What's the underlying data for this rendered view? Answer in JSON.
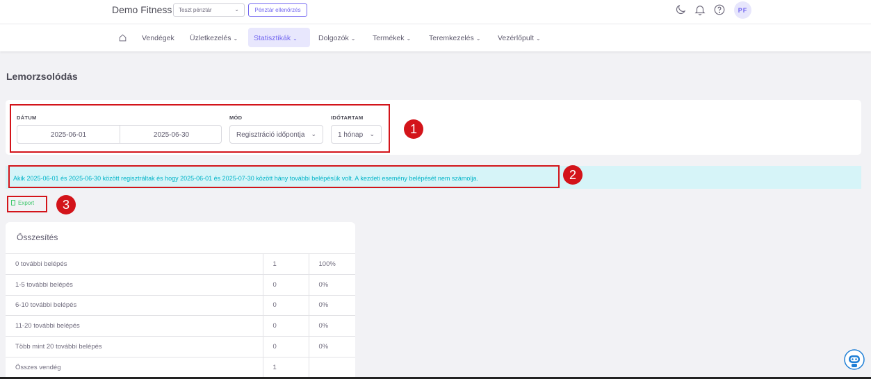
{
  "header": {
    "brand": "Demo Fitness",
    "cash_select": "Teszt pénztár",
    "cash_check_button": "Pénztár ellenőrzés",
    "avatar_initials": "PF"
  },
  "nav": {
    "items": [
      {
        "label": "Vendégek",
        "has_dropdown": false
      },
      {
        "label": "Üzletkezelés",
        "has_dropdown": true
      },
      {
        "label": "Statisztikák",
        "has_dropdown": true,
        "active": true
      },
      {
        "label": "Dolgozók",
        "has_dropdown": true
      },
      {
        "label": "Termékek",
        "has_dropdown": true
      },
      {
        "label": "Teremkezelés",
        "has_dropdown": true
      },
      {
        "label": "Vezérlőpult",
        "has_dropdown": true
      }
    ]
  },
  "page": {
    "title": "Lemorzsolódás"
  },
  "filters": {
    "date_label": "DÁTUM",
    "date_from": "2025-06-01",
    "date_to": "2025-06-30",
    "mode_label": "MÓD",
    "mode_value": "Regisztráció időpontja",
    "duration_label": "IDŐTARTAM",
    "duration_value": "1 hónap"
  },
  "info": {
    "text": "Akik 2025-06-01 és 2025-06-30 között regisztráltak és hogy 2025-06-01 és 2025-07-30 között hány további belépésük volt. A kezdeti esemény belépését nem számolja."
  },
  "export": {
    "label": "Export"
  },
  "callouts": [
    "1",
    "2",
    "3"
  ],
  "summary": {
    "title": "Összesítés",
    "rows": [
      {
        "label": "0 további belépés",
        "count": "1",
        "percent": "100%"
      },
      {
        "label": "1-5 további belépés",
        "count": "0",
        "percent": "0%"
      },
      {
        "label": "6-10 további belépés",
        "count": "0",
        "percent": "0%"
      },
      {
        "label": "11-20 további belépés",
        "count": "0",
        "percent": "0%"
      },
      {
        "label": "Több mint 20 további belépés",
        "count": "0",
        "percent": "0%"
      },
      {
        "label": "Összes vendég",
        "count": "1",
        "percent": ""
      }
    ]
  },
  "colors": {
    "accent": "#7367f0",
    "annotation_red": "#d3141a",
    "info_bg": "#d6f4f8",
    "info_text": "#00b4c8",
    "export_green": "#3dc76a"
  },
  "icons": [
    "moon-icon",
    "bell-icon",
    "help-icon",
    "home-icon",
    "file-icon",
    "chat-bot-icon"
  ]
}
